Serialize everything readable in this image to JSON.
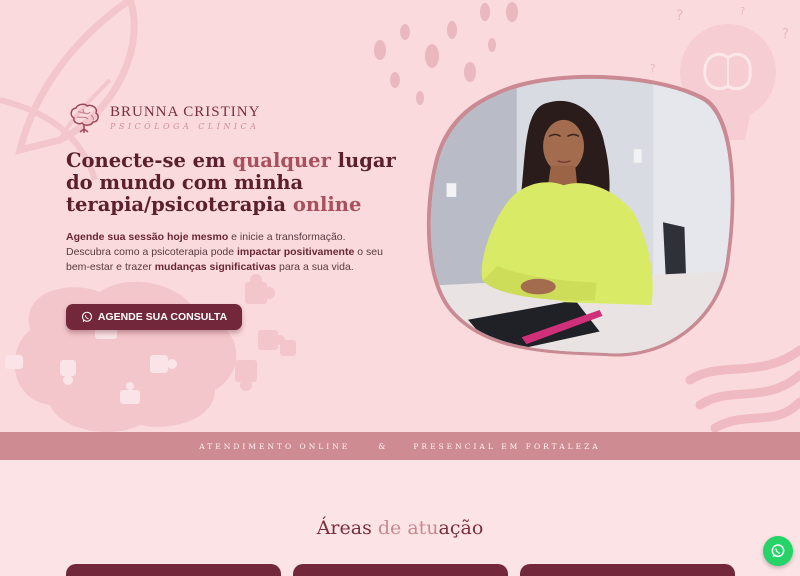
{
  "brand": {
    "name": "BRUNNA CRISTINY",
    "subtitle": "PSICÓLOGA CLÍNICA"
  },
  "hero": {
    "headline_parts": [
      "Conecte-se em ",
      "qualquer",
      " lugar do mundo com minha terapia/psicoterapia ",
      "online"
    ],
    "lead_parts": [
      "Agende sua sessão hoje mesmo",
      " e inicie a transformação. Descubra como a psicoterapia pode ",
      "impactar positivamente",
      " o seu bem-estar e trazer ",
      "mudanças significativas",
      " para a sua vida."
    ],
    "cta_label": "AGENDE SUA CONSULTA",
    "photo_icon": "portrait-photo"
  },
  "band": {
    "left": "ATENDIMENTO ONLINE",
    "separator": "&",
    "right": "PRESENCIAL EM FORTALEZA"
  },
  "section": {
    "title_parts": [
      "Áreas ",
      "de atu",
      "ação"
    ]
  },
  "floating": {
    "whatsapp_icon": "whatsapp-icon"
  },
  "colors": {
    "hero_bg": "#fadadd",
    "accent": "#73273a",
    "band": "#cf8b92",
    "whatsapp": "#25d366"
  }
}
